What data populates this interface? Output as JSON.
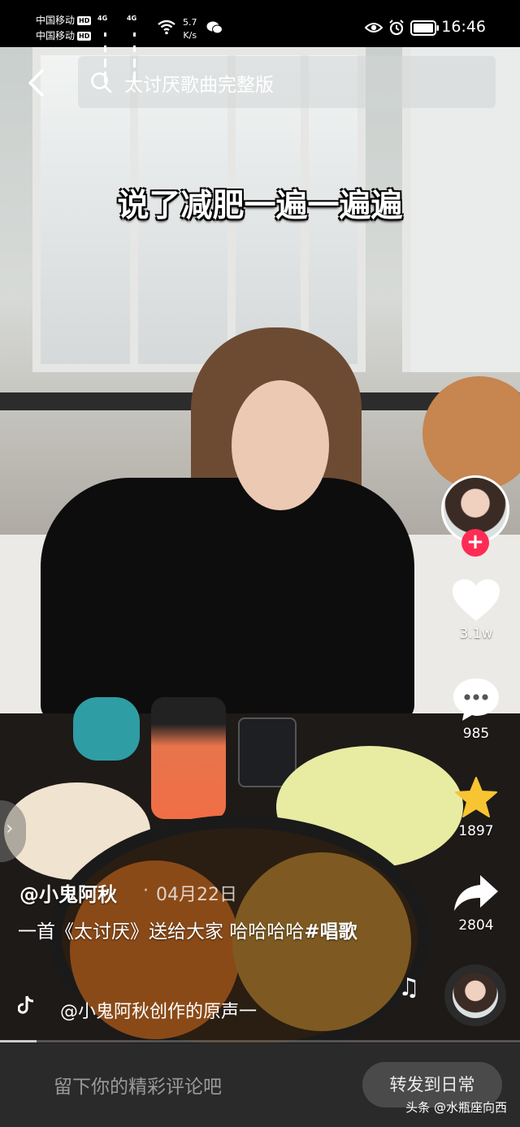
{
  "status_bar": {
    "carrier1": "中国移动",
    "carrier2": "中国移动",
    "hd_badge": "HD",
    "net_type": "4G",
    "net_speed_value": "5.7",
    "net_speed_unit": "K/s",
    "time": "16:46"
  },
  "search": {
    "query": "太讨厌歌曲完整版"
  },
  "video": {
    "caption": "说了减肥一遍一遍遍"
  },
  "actions": {
    "likes": "3.1w",
    "comments": "985",
    "favorites": "1897",
    "shares": "2804"
  },
  "post": {
    "author": "@小鬼阿秋",
    "dot": "·",
    "date": "04月22日",
    "description": "一首《太讨厌》送给大家 哈哈哈哈",
    "hashtag": "#唱歌",
    "music": "@小鬼阿秋创作的原声一",
    "progress": 0.07
  },
  "bottom_bar": {
    "comment_placeholder": "留下你的精彩评论吧",
    "share_button": "转发到日常",
    "watermark": "头条 @水瓶座向西"
  },
  "colors": {
    "follow_red": "#fe2c55",
    "favorite_gold": "#f7c531",
    "bottom_bar_bg": "#2a2a2a"
  }
}
